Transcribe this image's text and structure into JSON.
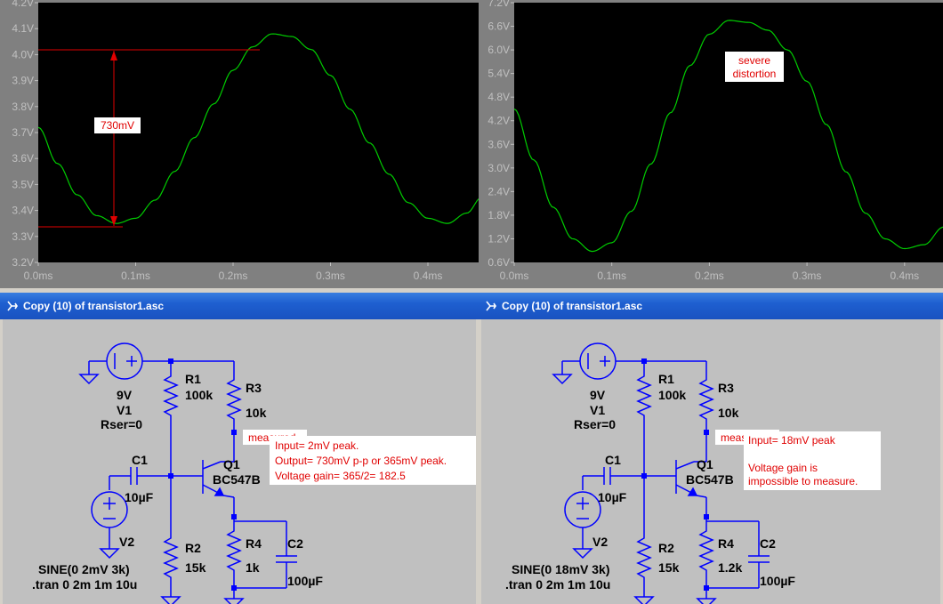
{
  "plots": [
    {
      "yticks": [
        "4.2V",
        "4.1V",
        "4.0V",
        "3.9V",
        "3.8V",
        "3.7V",
        "3.6V",
        "3.5V",
        "3.4V",
        "3.3V",
        "3.2V"
      ],
      "xticks": [
        "0.0ms",
        "0.1ms",
        "0.2ms",
        "0.3ms",
        "0.4ms"
      ],
      "annotation": "730mV"
    },
    {
      "yticks": [
        "7.2V",
        "6.6V",
        "6.0V",
        "5.4V",
        "4.8V",
        "4.2V",
        "3.6V",
        "3.0V",
        "2.4V",
        "1.8V",
        "1.2V",
        "0.6V"
      ],
      "xticks": [
        "0.0ms",
        "0.1ms",
        "0.2ms",
        "0.3ms",
        "0.4ms"
      ],
      "annotation_line1": "severe",
      "annotation_line2": "distortion"
    }
  ],
  "chart_data": [
    {
      "type": "line",
      "x_unit": "ms",
      "y_unit": "V",
      "ylim": [
        3.2,
        4.2
      ],
      "xlim": [
        0.0,
        0.455
      ],
      "series": [
        {
          "color": "#00cc00",
          "x": [
            0.0,
            0.02,
            0.04,
            0.06,
            0.08,
            0.1,
            0.12,
            0.14,
            0.16,
            0.18,
            0.2,
            0.22,
            0.24,
            0.26,
            0.28,
            0.3,
            0.32,
            0.34,
            0.36,
            0.38,
            0.4,
            0.42,
            0.44,
            0.455
          ],
          "y": [
            3.72,
            3.58,
            3.46,
            3.38,
            3.35,
            3.37,
            3.44,
            3.55,
            3.68,
            3.81,
            3.94,
            4.03,
            4.08,
            4.07,
            4.02,
            3.92,
            3.79,
            3.66,
            3.54,
            3.43,
            3.37,
            3.35,
            3.39,
            3.45
          ]
        }
      ],
      "markers": {
        "max": 4.08,
        "min": 3.35
      }
    },
    {
      "type": "line",
      "x_unit": "ms",
      "y_unit": "V",
      "ylim": [
        0.6,
        7.2
      ],
      "xlim": [
        0.0,
        0.455
      ],
      "series": [
        {
          "color": "#00cc00",
          "x": [
            0.0,
            0.02,
            0.04,
            0.06,
            0.08,
            0.1,
            0.12,
            0.14,
            0.16,
            0.18,
            0.2,
            0.22,
            0.24,
            0.26,
            0.28,
            0.3,
            0.32,
            0.34,
            0.36,
            0.38,
            0.4,
            0.42,
            0.44,
            0.455
          ],
          "y": [
            4.5,
            3.2,
            2.0,
            1.2,
            0.88,
            1.1,
            1.9,
            3.1,
            4.4,
            5.6,
            6.4,
            6.75,
            6.7,
            6.5,
            6.0,
            5.2,
            4.1,
            2.9,
            1.85,
            1.2,
            0.95,
            1.05,
            1.5,
            1.85
          ]
        }
      ]
    }
  ],
  "windows": [
    {
      "title": "Copy (10) of transistor1.asc",
      "labels": {
        "v1_val": "9V",
        "v1_name": "V1",
        "v1_rser": "Rser=0",
        "r1_name": "R1",
        "r1_val": "100k",
        "r3_name": "R3",
        "r3_val": "10k",
        "measured": "measured",
        "c1_name": "C1",
        "c1_val": "10µF",
        "q1_name": "Q1",
        "q1_model": "BC547B",
        "v2_name": "V2",
        "r2_name": "R2",
        "r2_val": "15k",
        "r4_name": "R4",
        "r4_val": "1k",
        "c2_name": "C2",
        "c2_val": "100µF",
        "sine": "SINE(0 2mV 3k)",
        "tran": ".tran 0 2m 1m 10u"
      },
      "note": [
        "Input= 2mV peak.",
        "Output= 730mV p-p or 365mV peak.",
        "Voltage gain= 365/2= 182.5"
      ]
    },
    {
      "title": "Copy (10) of transistor1.asc",
      "labels": {
        "v1_val": "9V",
        "v1_name": "V1",
        "v1_rser": "Rser=0",
        "r1_name": "R1",
        "r1_val": "100k",
        "r3_name": "R3",
        "r3_val": "10k",
        "measured": "measured",
        "c1_name": "C1",
        "c1_val": "10µF",
        "q1_name": "Q1",
        "q1_model": "BC547B",
        "v2_name": "V2",
        "r2_name": "R2",
        "r2_val": "15k",
        "r4_name": "R4",
        "r4_val": "1.2k",
        "c2_name": "C2",
        "c2_val": "100µF",
        "sine": "SINE(0 18mV 3k)",
        "tran": ".tran 0 2m 1m 10u"
      },
      "note": [
        "Input= 18mV peak",
        "",
        "Voltage gain is",
        "impossible to measure."
      ]
    }
  ]
}
